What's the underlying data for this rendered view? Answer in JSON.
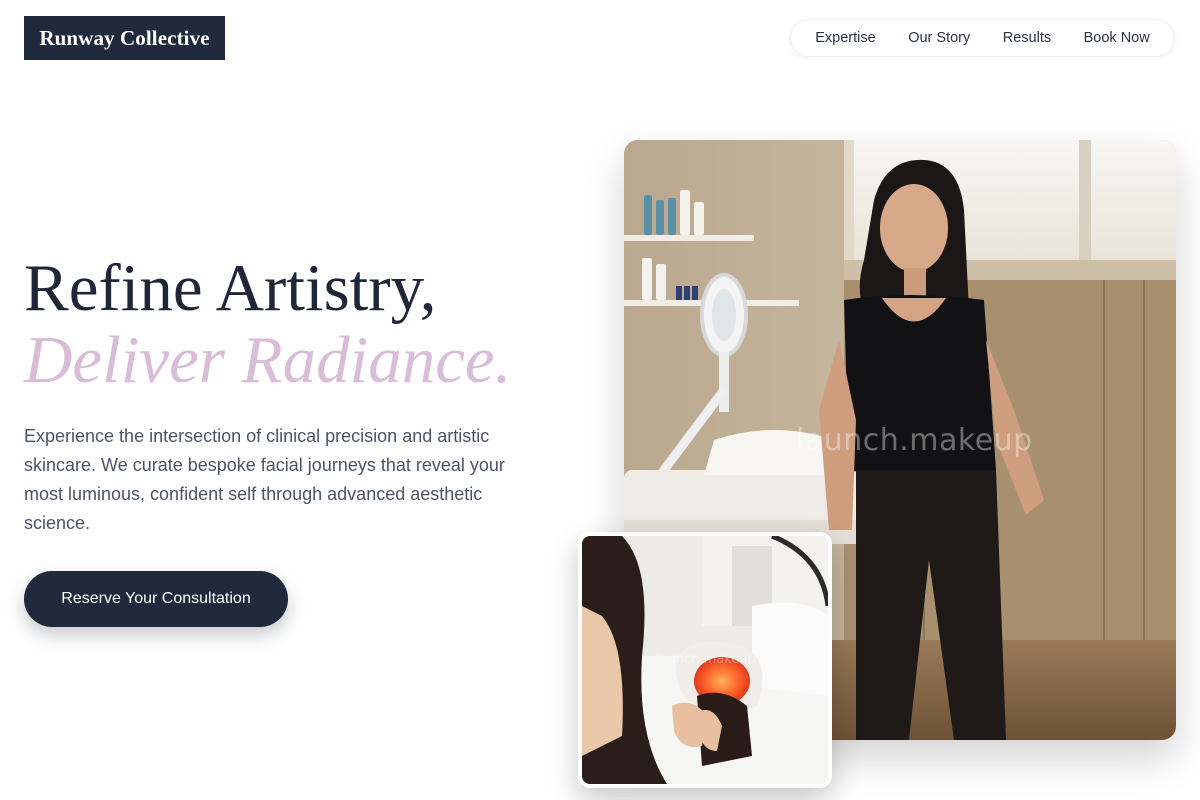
{
  "brand": {
    "name": "Runway Collective"
  },
  "nav": {
    "items": [
      {
        "label": "Expertise"
      },
      {
        "label": "Our Story"
      },
      {
        "label": "Results"
      },
      {
        "label": "Book Now"
      }
    ]
  },
  "hero": {
    "title_line1": "Refine Artistry,",
    "title_line2": "Deliver Radiance.",
    "description": "Experience the intersection of clinical precision and artistic skincare. We curate bespoke facial journeys that reveal your most luminous, confident self through advanced aesthetic science.",
    "cta_label": "Reserve Your Consultation"
  },
  "media": {
    "main_watermark": "launch.makeup",
    "inset_watermark": "launch.makeup"
  },
  "colors": {
    "navy": "#1f2a3d",
    "accent_lilac": "#d9bdd8",
    "body_text": "#4a5468"
  }
}
